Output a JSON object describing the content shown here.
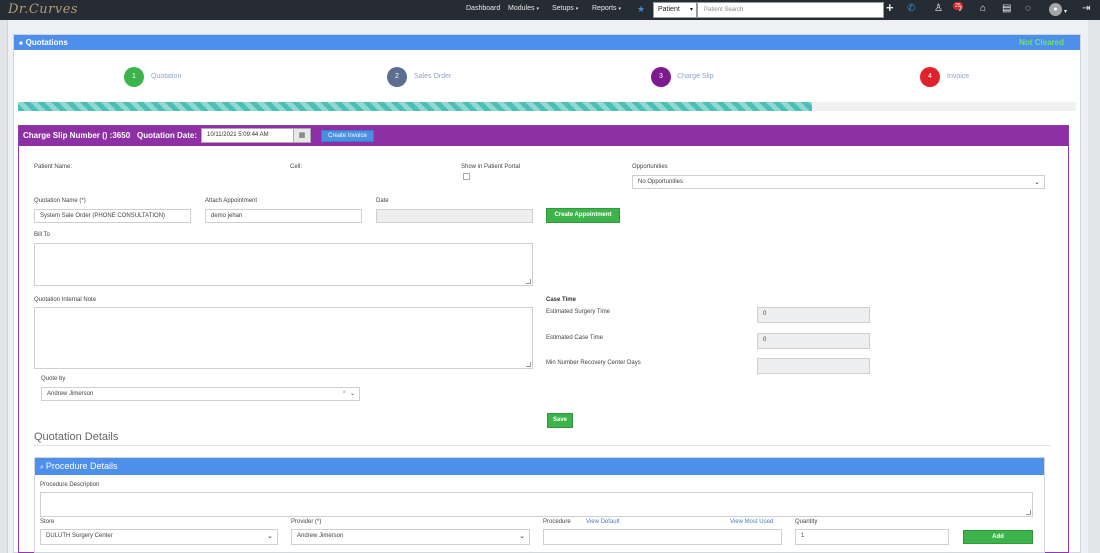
{
  "navbar": {
    "brand": "Dr.Curves",
    "links": [
      {
        "label": "Dashboard",
        "has_caret": false
      },
      {
        "label": "Modules",
        "has_caret": true
      },
      {
        "label": "Setups",
        "has_caret": true
      },
      {
        "label": "Reports",
        "has_caret": true
      }
    ],
    "search_type": "Patient",
    "search_placeholder": "Patient Search",
    "notification_count": "25",
    "icons": [
      "star-icon",
      "plus-icon",
      "phone-icon",
      "user-alert-icon",
      "bell-icon",
      "home-icon",
      "message-icon",
      "chat-icon",
      "user-avatar-icon",
      "logout-icon"
    ]
  },
  "quotation_panel": {
    "title": "Quotations",
    "status": "Not Cleared",
    "steps": [
      {
        "number": "1",
        "label": "Quotation",
        "color": "#3cb44b"
      },
      {
        "number": "2",
        "label": "Sales Order",
        "color": "#5c6f8f"
      },
      {
        "number": "3",
        "label": "Charge Slip",
        "color": "#7d1a8f"
      },
      {
        "number": "4",
        "label": "Invoice",
        "color": "#e0222c"
      }
    ],
    "progress_fraction": 0.75
  },
  "charge_slip": {
    "title": "Charge Slip Number () :3650",
    "date_label": "Quotation Date:",
    "date_value": "10/11/2021 5:09:44 AM",
    "create_invoice_label": "Create Invoice",
    "patient_name_label": "Patient Name:",
    "cell_label": "Cell:",
    "show_portal_label": "Show in Patient Portal",
    "opportunities_label": "Opportunities",
    "opportunities_value": "No Opportunities",
    "quotation_name_label": "Quotation Name (*)",
    "quotation_name_value": "System Sale Order (PHONE CONSULTATION)",
    "attach_appointment_label": "Attach Appointment",
    "attach_appointment_value": "demo jehan",
    "date_field_label": "Date",
    "create_appointment_label": "Create Appointment",
    "bill_to_label": "Bill To",
    "internal_note_label": "Quotation Internal Note",
    "case_time_label": "Case Time",
    "est_surgery_time_label": "Estimated Surgery Time",
    "est_surgery_time_value": "0",
    "est_case_time_label": "Estimated Case Time",
    "est_case_time_value": "0",
    "min_recovery_label": "Min Number Recovery Center Days",
    "quote_by_label": "Quote by",
    "quote_by_value": "Andrew Jimerson",
    "save_label": "Save"
  },
  "quotation_details": {
    "title": "Quotation Details",
    "procedure_panel_title": "Procedure Details",
    "procedure_description_label": "Procedure Description",
    "store_label": "Store",
    "store_value": "DULUTH Surgery Center",
    "provider_label": "Provider (*)",
    "provider_value": "Andrew Jimerson",
    "procedure_label": "Procedure",
    "view_default_label": "View Default",
    "view_most_used_label": "View Most Used",
    "quantity_label": "Quantity",
    "quantity_value": "1",
    "add_label": "Add"
  }
}
